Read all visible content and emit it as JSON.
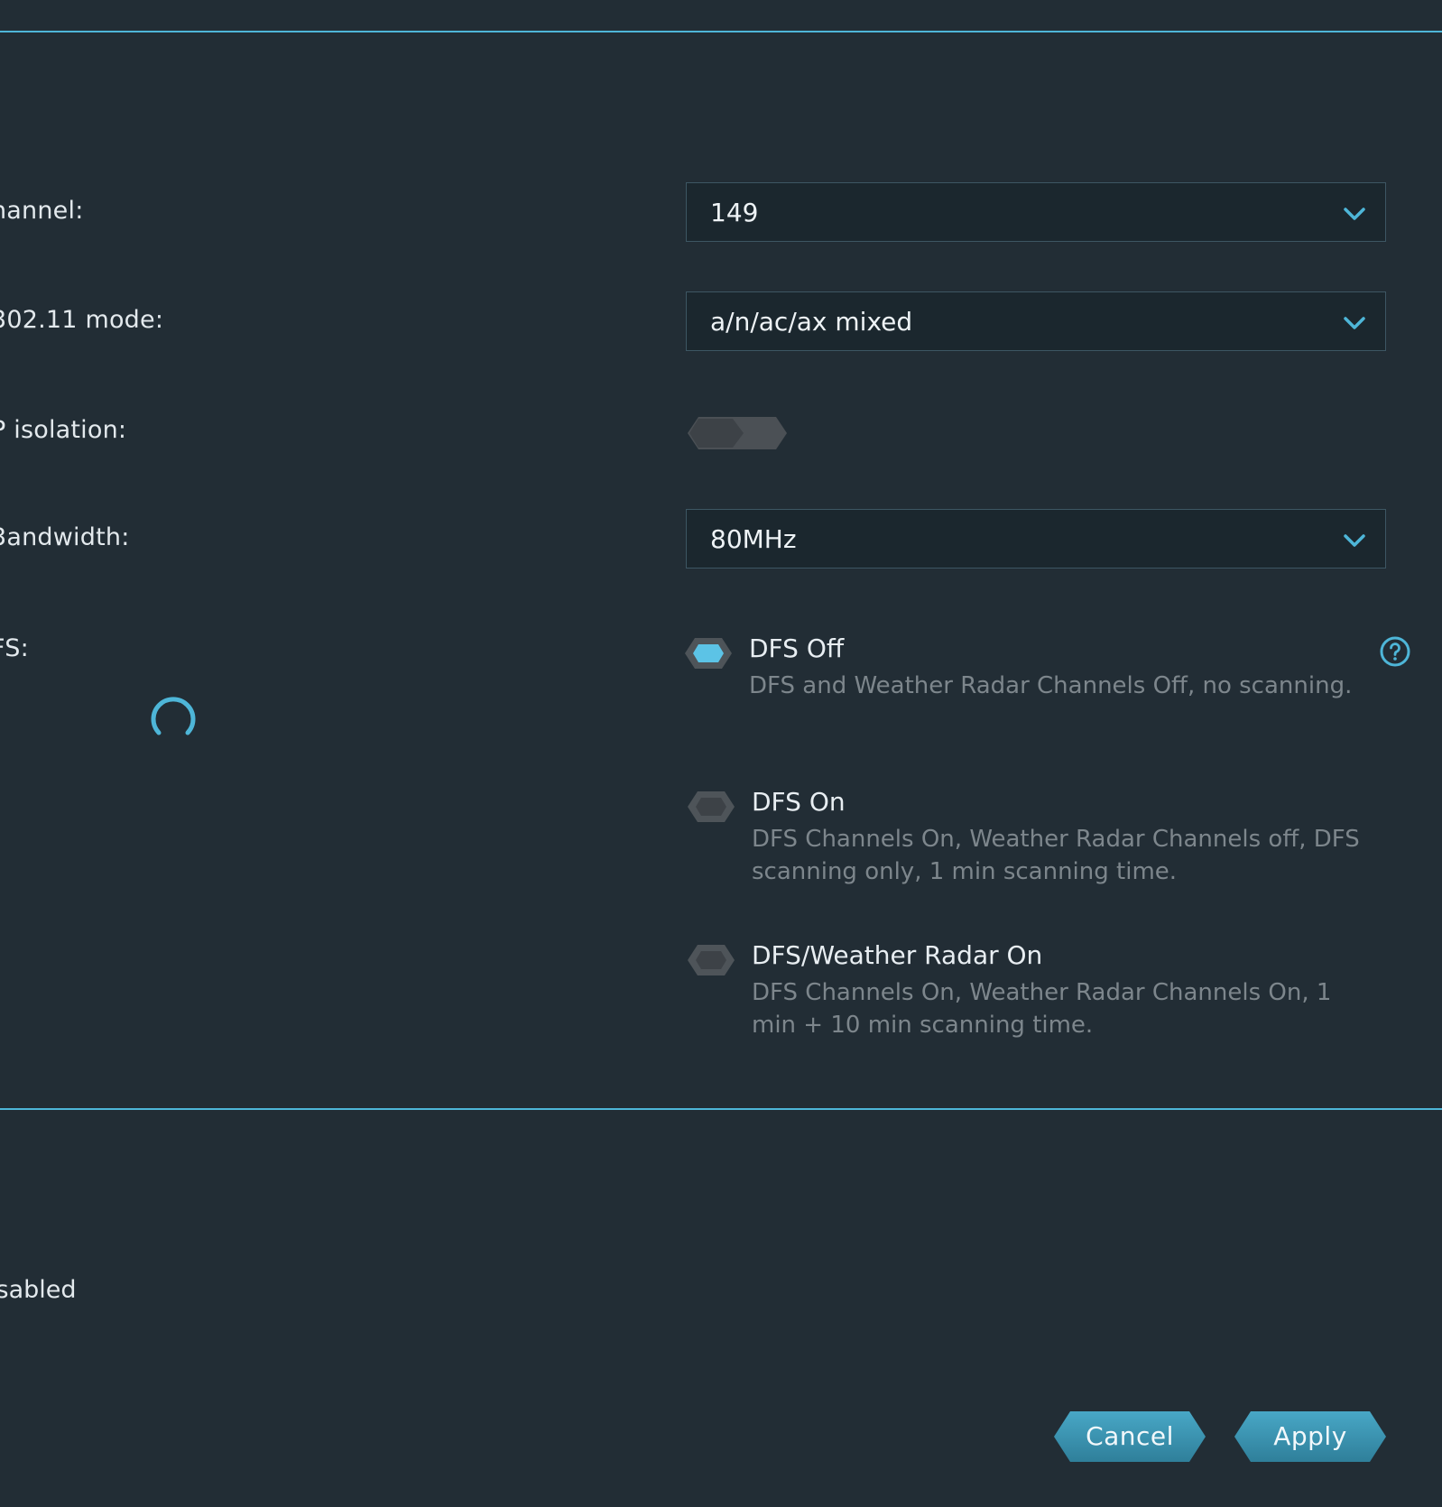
{
  "wireless": {
    "channel_label": "hannel:",
    "channel_value": "149",
    "mode_label": "302.11 mode:",
    "mode_value": "a/n/ac/ax mixed",
    "ap_isolation_label": "P isolation:",
    "ap_isolation_on": false,
    "bandwidth_label": "3andwidth:",
    "bandwidth_value": "80MHz",
    "dfs_label": "FS:",
    "dfs_options": [
      {
        "title": "DFS Off",
        "desc": "DFS and Weather Radar Channels Off, no scanning.",
        "selected": true
      },
      {
        "title": "DFS On",
        "desc": "DFS Channels On, Weather Radar Channels off, DFS scanning only, 1 min scanning time.",
        "selected": false
      },
      {
        "title": "DFS/Weather Radar On",
        "desc": "DFS Channels On, Weather Radar Channels On, 1 min + 10 min scanning time.",
        "selected": false
      }
    ]
  },
  "status": {
    "text": "isabled"
  },
  "actions": {
    "cancel_label": "Cancel",
    "apply_label": "Apply"
  },
  "colors": {
    "accent": "#4eb6d8",
    "background": "#222d35",
    "field_bg": "#1b272e",
    "button": "#3c8fab",
    "radio_off": "#555a5e"
  },
  "icons": {
    "select_arrow": "chevron-down-icon",
    "help": "help-circle-icon",
    "loading": "spinner-icon"
  }
}
